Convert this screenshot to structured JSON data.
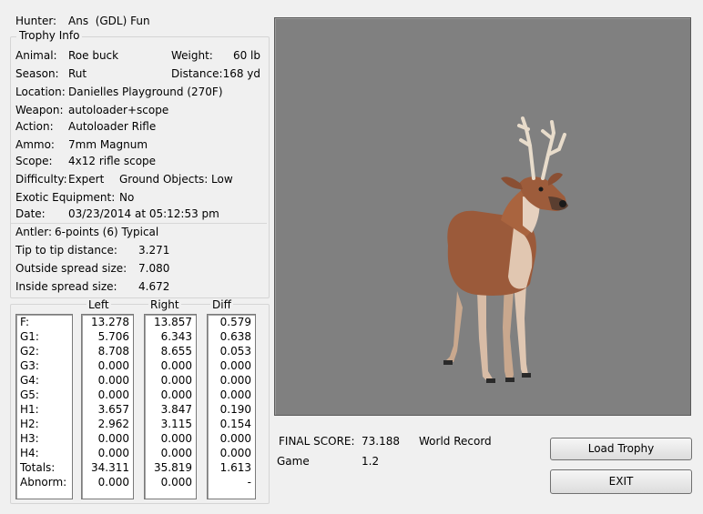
{
  "hunter": {
    "label": "Hunter:",
    "value": "Ans  (GDL) Fun"
  },
  "trophy_info": {
    "title": "Trophy Info",
    "animal": {
      "label": "Animal:",
      "value": "Roe buck"
    },
    "weight": {
      "label": "Weight:",
      "value": "60 lb"
    },
    "season": {
      "label": "Season:",
      "value": "Rut"
    },
    "distance": {
      "label": "Distance:",
      "value": "168 yd"
    },
    "location": {
      "label": "Location:",
      "value": "Danielles Playground (270F)"
    },
    "weapon": {
      "label": "Weapon:",
      "value": "autoloader+scope"
    },
    "action": {
      "label": "Action:",
      "value": "Autoloader Rifle"
    },
    "ammo": {
      "label": "Ammo:",
      "value": "7mm Magnum"
    },
    "scope": {
      "label": "Scope:",
      "value": "4x12 rifle scope"
    },
    "difficulty": {
      "label": "Difficulty:",
      "value": "Expert"
    },
    "ground_objects": {
      "label": "Ground Objects:",
      "value": "Low"
    },
    "exotic_equipment": {
      "label": "Exotic Equipment:",
      "value": "No"
    },
    "date": {
      "label": "Date:",
      "value": "03/23/2014 at 05:12:53 pm"
    }
  },
  "antler": {
    "type": {
      "label": "Antler:",
      "value": "6-points (6) Typical"
    },
    "tip_to_tip": {
      "label": "Tip to tip distance:",
      "value": "3.271"
    },
    "outside_spread": {
      "label": "Outside spread size:",
      "value": "7.080"
    },
    "inside_spread": {
      "label": "Inside spread size:",
      "value": "4.672"
    }
  },
  "measurements": {
    "headers": {
      "left": "Left",
      "right": "Right",
      "diff": "Diff"
    },
    "rows": [
      {
        "name": "F:",
        "left": "13.278",
        "right": "13.857",
        "diff": "0.579"
      },
      {
        "name": "G1:",
        "left": "5.706",
        "right": "6.343",
        "diff": "0.638"
      },
      {
        "name": "G2:",
        "left": "8.708",
        "right": "8.655",
        "diff": "0.053"
      },
      {
        "name": "G3:",
        "left": "0.000",
        "right": "0.000",
        "diff": "0.000"
      },
      {
        "name": "G4:",
        "left": "0.000",
        "right": "0.000",
        "diff": "0.000"
      },
      {
        "name": "G5:",
        "left": "0.000",
        "right": "0.000",
        "diff": "0.000"
      },
      {
        "name": "H1:",
        "left": "3.657",
        "right": "3.847",
        "diff": "0.190"
      },
      {
        "name": "H2:",
        "left": "2.962",
        "right": "3.115",
        "diff": "0.154"
      },
      {
        "name": "H3:",
        "left": "0.000",
        "right": "0.000",
        "diff": "0.000"
      },
      {
        "name": "H4:",
        "left": "0.000",
        "right": "0.000",
        "diff": "0.000"
      },
      {
        "name": "Totals:",
        "left": "34.311",
        "right": "35.819",
        "diff": "1.613"
      },
      {
        "name": "Abnorm:",
        "left": "0.000",
        "right": "0.000",
        "diff": "-"
      }
    ]
  },
  "score": {
    "final_label": "FINAL SCORE:",
    "final_value": "73.188",
    "record": "World Record",
    "game_label": "Game",
    "game_value": "1.2"
  },
  "buttons": {
    "load_trophy": "Load Trophy",
    "exit": "EXIT"
  },
  "colors": {
    "viewport_bg": "#808080",
    "window_bg": "#f0f0f0"
  },
  "viewport_content": "roe-buck-3d-model"
}
